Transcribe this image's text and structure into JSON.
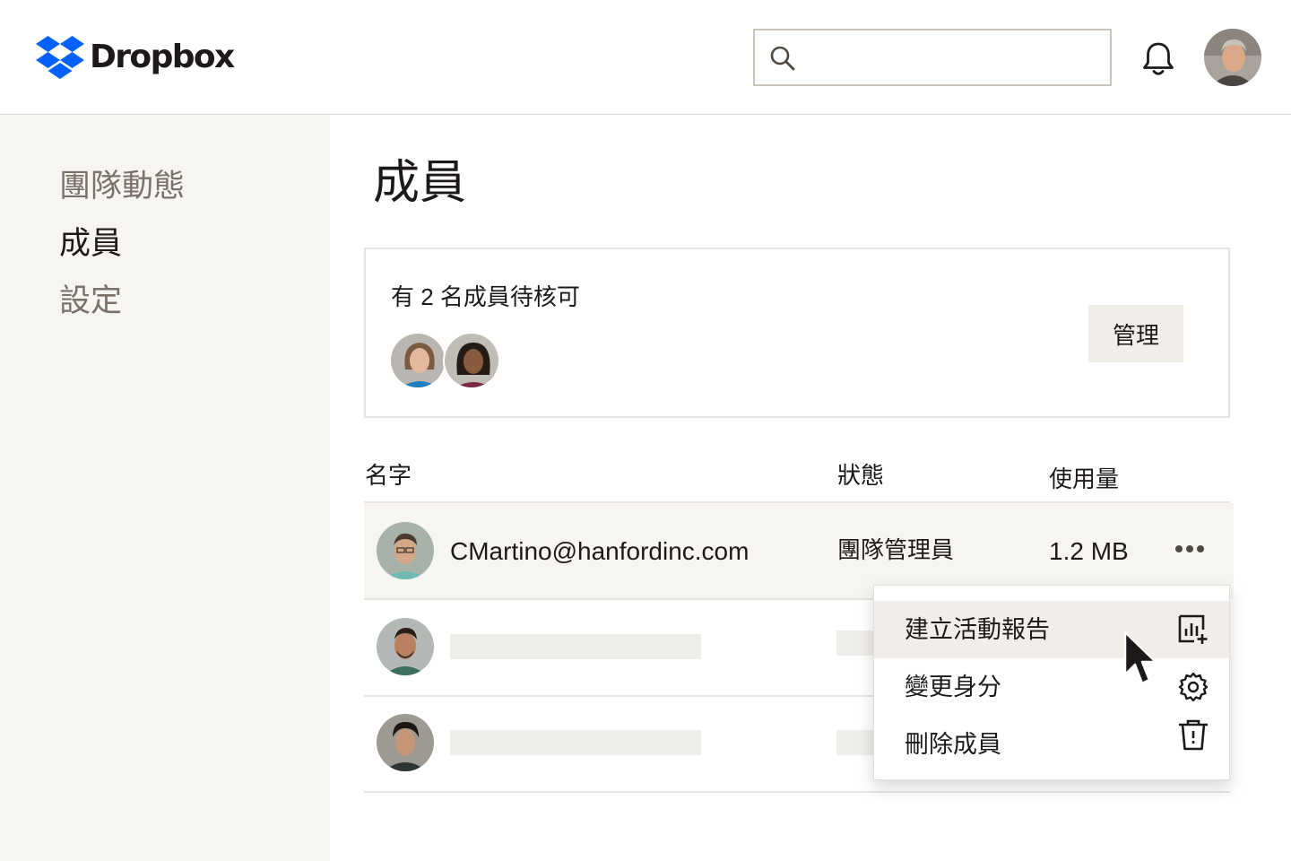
{
  "brand": {
    "name": "Dropbox",
    "color": "#0061fe"
  },
  "header": {
    "search": {
      "placeholder": "",
      "value": "",
      "icon": "search-icon"
    },
    "notifications": {
      "icon": "bell-icon"
    },
    "user_avatar": "avatar"
  },
  "sidebar": {
    "items": [
      {
        "label": "團隊動態",
        "active": false
      },
      {
        "label": "成員",
        "active": true
      },
      {
        "label": "設定",
        "active": false
      }
    ]
  },
  "main": {
    "title": "成員",
    "pending": {
      "text": "有 2 名成員待核可",
      "manage_label": "管理"
    },
    "table": {
      "columns": [
        "名字",
        "狀態",
        "使用量"
      ],
      "rows": [
        {
          "email": "CMartino@hanfordinc.com",
          "status": "團隊管理員",
          "usage": "1.2 MB",
          "highlighted": true
        },
        {
          "email": "",
          "status": "",
          "usage": "",
          "highlighted": false
        },
        {
          "email": "",
          "status": "",
          "usage": "",
          "highlighted": false
        }
      ]
    },
    "menu": {
      "items": [
        {
          "label": "建立活動報告",
          "icon": "report-add-icon"
        },
        {
          "label": "變更身分",
          "icon": "gear-icon"
        },
        {
          "label": "刪除成員",
          "icon": "trash-icon"
        }
      ]
    }
  }
}
